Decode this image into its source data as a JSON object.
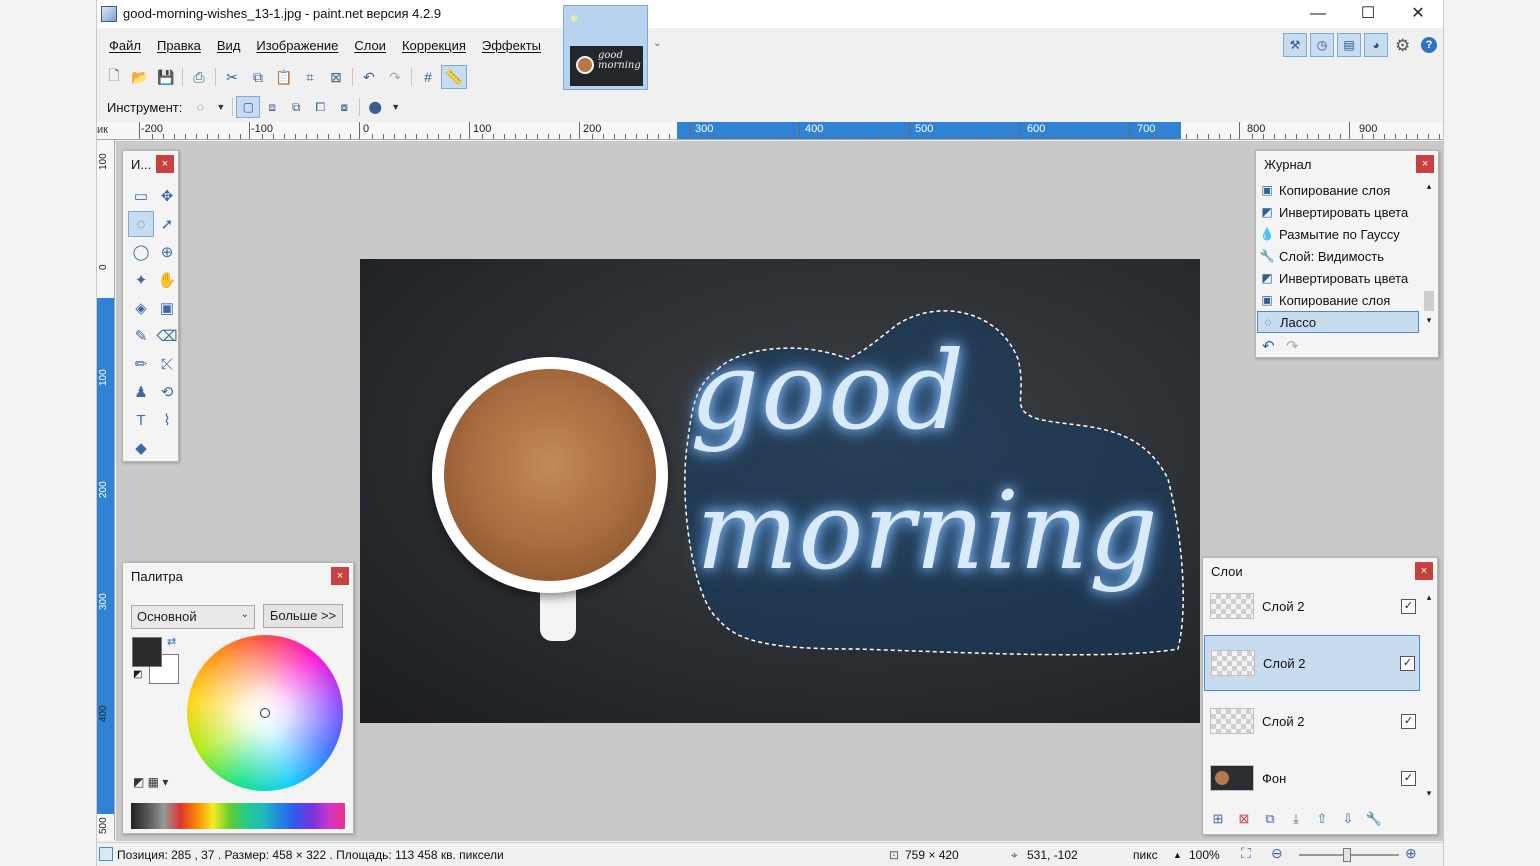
{
  "window": {
    "title": "good-morning-wishes_13-1.jpg - paint.net версия 4.2.9",
    "minimize": "—",
    "maximize": "☐",
    "close": "✕"
  },
  "menu": [
    "Файл",
    "Правка",
    "Вид",
    "Изображение",
    "Слои",
    "Коррекция",
    "Эффекты"
  ],
  "thumbnail": {
    "caption": "good morning",
    "chevron": "⌄"
  },
  "toolbar": {
    "instrument_label": "Инструмент:",
    "icons": [
      "new-icon",
      "open-icon",
      "save-icon",
      "print-icon",
      "cut-icon",
      "copy-icon",
      "paste-icon",
      "crop-icon",
      "deselect-icon",
      "undo-icon",
      "redo-icon",
      "grid-icon",
      "ruler-icon"
    ]
  },
  "ruler": {
    "unit": "ик",
    "top_labels": [
      "-200",
      "-100",
      "0",
      "100",
      "200",
      "300",
      "400",
      "500",
      "600",
      "700",
      "800",
      "900"
    ],
    "left_labels": [
      "100",
      "0",
      "100",
      "200",
      "300",
      "400",
      "500"
    ]
  },
  "canvas": {
    "text_line1": "good",
    "text_line2": "morning"
  },
  "tools_panel": {
    "title": "И...",
    "close": "×",
    "tools": [
      {
        "name": "rectangle-select-tool",
        "glyph": "▭"
      },
      {
        "name": "move-selected-pixels-tool",
        "glyph": "✥"
      },
      {
        "name": "lasso-select-tool",
        "glyph": "◌"
      },
      {
        "name": "move-selection-tool",
        "glyph": "➚"
      },
      {
        "name": "ellipse-select-tool",
        "glyph": "◯"
      },
      {
        "name": "zoom-tool",
        "glyph": "⊕"
      },
      {
        "name": "magic-wand-tool",
        "glyph": "✦"
      },
      {
        "name": "pan-tool",
        "glyph": "✋"
      },
      {
        "name": "paint-bucket-tool",
        "glyph": "◈"
      },
      {
        "name": "gradient-tool",
        "glyph": "▣"
      },
      {
        "name": "paintbrush-tool",
        "glyph": "✎"
      },
      {
        "name": "eraser-tool",
        "glyph": "⌫"
      },
      {
        "name": "pencil-tool",
        "glyph": "✏"
      },
      {
        "name": "color-picker-tool",
        "glyph": "⤪"
      },
      {
        "name": "clone-stamp-tool",
        "glyph": "♟"
      },
      {
        "name": "recolor-tool",
        "glyph": "⟲"
      },
      {
        "name": "text-tool",
        "glyph": "T"
      },
      {
        "name": "line-curve-tool",
        "glyph": "⌇"
      },
      {
        "name": "shapes-tool",
        "glyph": "◆"
      },
      {
        "name": "blank-tool",
        "glyph": ""
      }
    ]
  },
  "palette_panel": {
    "title": "Палитра",
    "close": "×",
    "mode": "Основной",
    "more": "Больше >>",
    "primary_color": "#2b2b2b",
    "secondary_color": "#ffffff",
    "swap_icon": "⇄"
  },
  "history_panel": {
    "title": "Журнал",
    "close": "×",
    "items": [
      {
        "label": "Копирование слоя",
        "icon": "▣"
      },
      {
        "label": "Инвертировать цвета",
        "icon": "◩"
      },
      {
        "label": "Размытие по Гауссу",
        "icon": "💧"
      },
      {
        "label": "Слой: Видимость",
        "icon": "🔧"
      },
      {
        "label": "Инвертировать цвета",
        "icon": "◩"
      },
      {
        "label": "Копирование слоя",
        "icon": "▣"
      },
      {
        "label": "Лассо",
        "icon": "◌"
      }
    ],
    "undo": "↶",
    "redo": "↷",
    "up": "▴",
    "down": "▾"
  },
  "layers_panel": {
    "title": "Слои",
    "close": "×",
    "layers": [
      {
        "name": "Слой 2",
        "checked": "✓"
      },
      {
        "name": "Слой 2",
        "checked": "✓"
      },
      {
        "name": "Слой 2",
        "checked": "✓"
      },
      {
        "name": "Фон",
        "checked": "✓"
      }
    ],
    "up": "▴",
    "down": "▾"
  },
  "status": {
    "position": "Позиция: 285 , 37 . Размер: 458  × 322 . Площадь: 113 458 кв. пиксели",
    "image_size": "759 × 420",
    "cursor": "531, -102",
    "unit": "пикс",
    "zoom": "100%"
  },
  "colors": {
    "accent": "#2f82d4",
    "selection": "#c8dcf0",
    "close_red": "#c94040"
  }
}
